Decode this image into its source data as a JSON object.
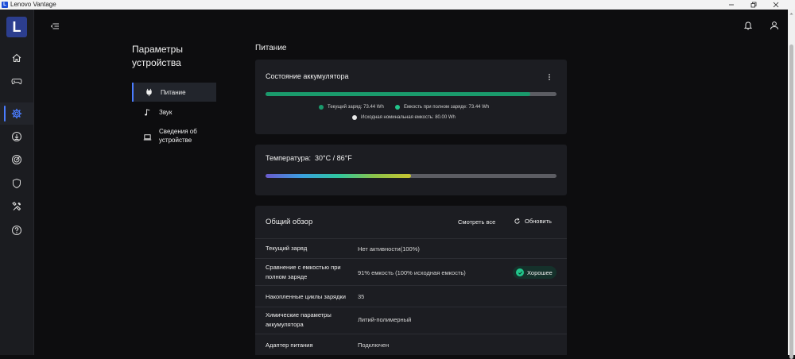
{
  "window": {
    "title": "Lenovo Vantage",
    "logo_letter": "L"
  },
  "rail": {
    "brand_letter": "L",
    "items": [
      {
        "icon": "home-icon"
      },
      {
        "icon": "gamepad-icon"
      },
      {
        "icon": "gear-icon",
        "active": true
      },
      {
        "icon": "download-icon"
      },
      {
        "icon": "radar-icon"
      },
      {
        "icon": "shield-icon"
      },
      {
        "icon": "tools-icon"
      },
      {
        "icon": "help-icon"
      }
    ]
  },
  "settings_nav": {
    "title": "Параметры устройства",
    "items": [
      {
        "label": "Питание",
        "icon": "plug-icon",
        "active": true
      },
      {
        "label": "Звук",
        "icon": "music-note-icon"
      },
      {
        "label": "Сведения об устройстве",
        "icon": "laptop-icon"
      }
    ]
  },
  "main": {
    "section_title": "Питание",
    "battery_status": {
      "title": "Состояние аккумулятора",
      "current_charge_fraction": 0.91,
      "legend": {
        "current_label": "Текущий заряд:",
        "current_value": "73.44 Wh",
        "full_label": "Емкость при полном заряде:",
        "full_value": "73.44 Wh",
        "design_label": "Исходная номинальная емкость:",
        "design_value": "80.00 Wh"
      },
      "colors": {
        "current": "#1a9a6c",
        "full": "#22c58b",
        "design": "#e8e8e8",
        "track": "#5c5d63"
      }
    },
    "temperature": {
      "label": "Температура:",
      "value": "30°C / 86°F",
      "level_fraction": 0.5
    },
    "overview": {
      "title": "Общий обзор",
      "view_all_label": "Смотреть все",
      "refresh_label": "Обновить",
      "rows": [
        {
          "key": "Текущий заряд",
          "value": "Нет активности(100%)"
        },
        {
          "key": "Сравнение с емкостью при полном заряде",
          "value": "91% емкость (100% исходная емкость)",
          "badge": "Хорошее"
        },
        {
          "key": "Накопленные циклы зарядки",
          "value": "35"
        },
        {
          "key": "Химические параметры аккумулятора",
          "value": "Литий-полимерный"
        },
        {
          "key": "Адаптер питания",
          "value": "Подключен"
        }
      ]
    }
  }
}
